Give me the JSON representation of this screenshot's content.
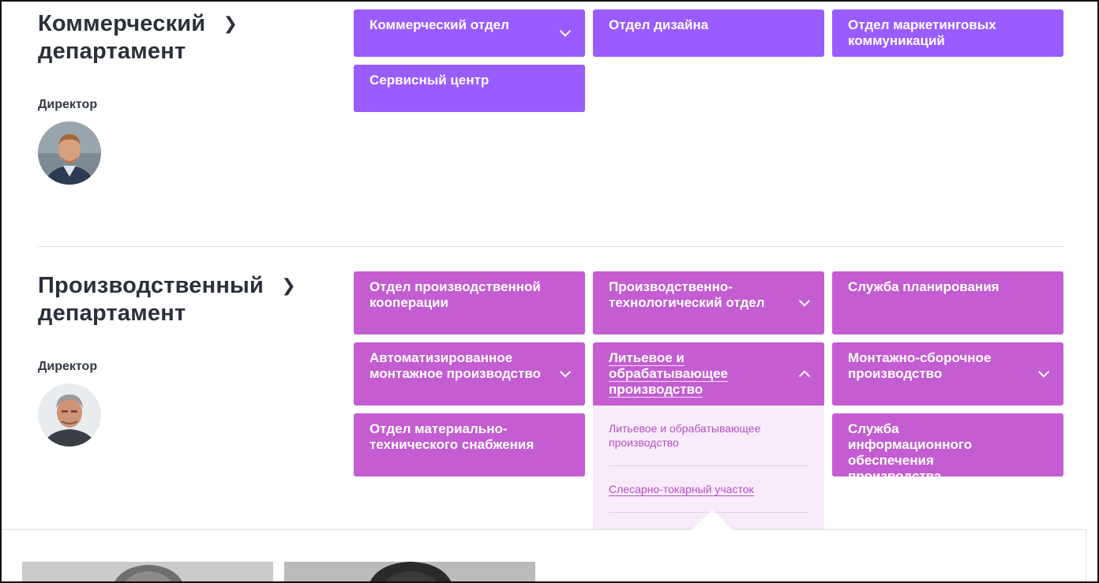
{
  "departments": [
    {
      "title": "Коммерческий департамент",
      "title_line1": "Коммерческий",
      "title_line2": "департамент",
      "director_label": "Директор",
      "color": "#9a5cff",
      "units": [
        {
          "label": "Коммерческий отдел",
          "expandable": true
        },
        {
          "label": "Отдел дизайна",
          "expandable": false
        },
        {
          "label": "Отдел маркетинговых коммуникаций",
          "expandable": false
        },
        {
          "label": "Сервисный центр",
          "expandable": false
        }
      ]
    },
    {
      "title": "Производственный департамент",
      "title_line1": "Производственный",
      "title_line2": "департамент",
      "director_label": "Директор",
      "color": "#c35dd1",
      "units": [
        {
          "label": "Отдел производственной кооперации",
          "expandable": false
        },
        {
          "label": "Производственно-технологический отдел",
          "expandable": true
        },
        {
          "label": "Служба планирования",
          "expandable": false
        },
        {
          "label": "Автоматизированное монтажное производство",
          "expandable": true
        },
        {
          "label": "Литьевое и обрабатывающее производство",
          "expandable": true,
          "expanded": true
        },
        {
          "label": "Монтажно-сборочное производство",
          "expandable": true
        },
        {
          "label": "Отдел материально-технического снабжения",
          "expandable": false
        },
        {
          "label": "Служба информационного обеспечения производства",
          "expandable": false
        }
      ],
      "open_dropdown": {
        "parent": "Литьевое и обрабатывающее производство",
        "items": [
          {
            "label": "Литьевое и обрабатывающее производство"
          },
          {
            "label": "Слесарно-токарный участок"
          }
        ]
      }
    }
  ],
  "icons": {
    "title_chevron": "chevron-right-icon",
    "expand": "chevron-down-icon",
    "collapse": "chevron-up-icon"
  }
}
